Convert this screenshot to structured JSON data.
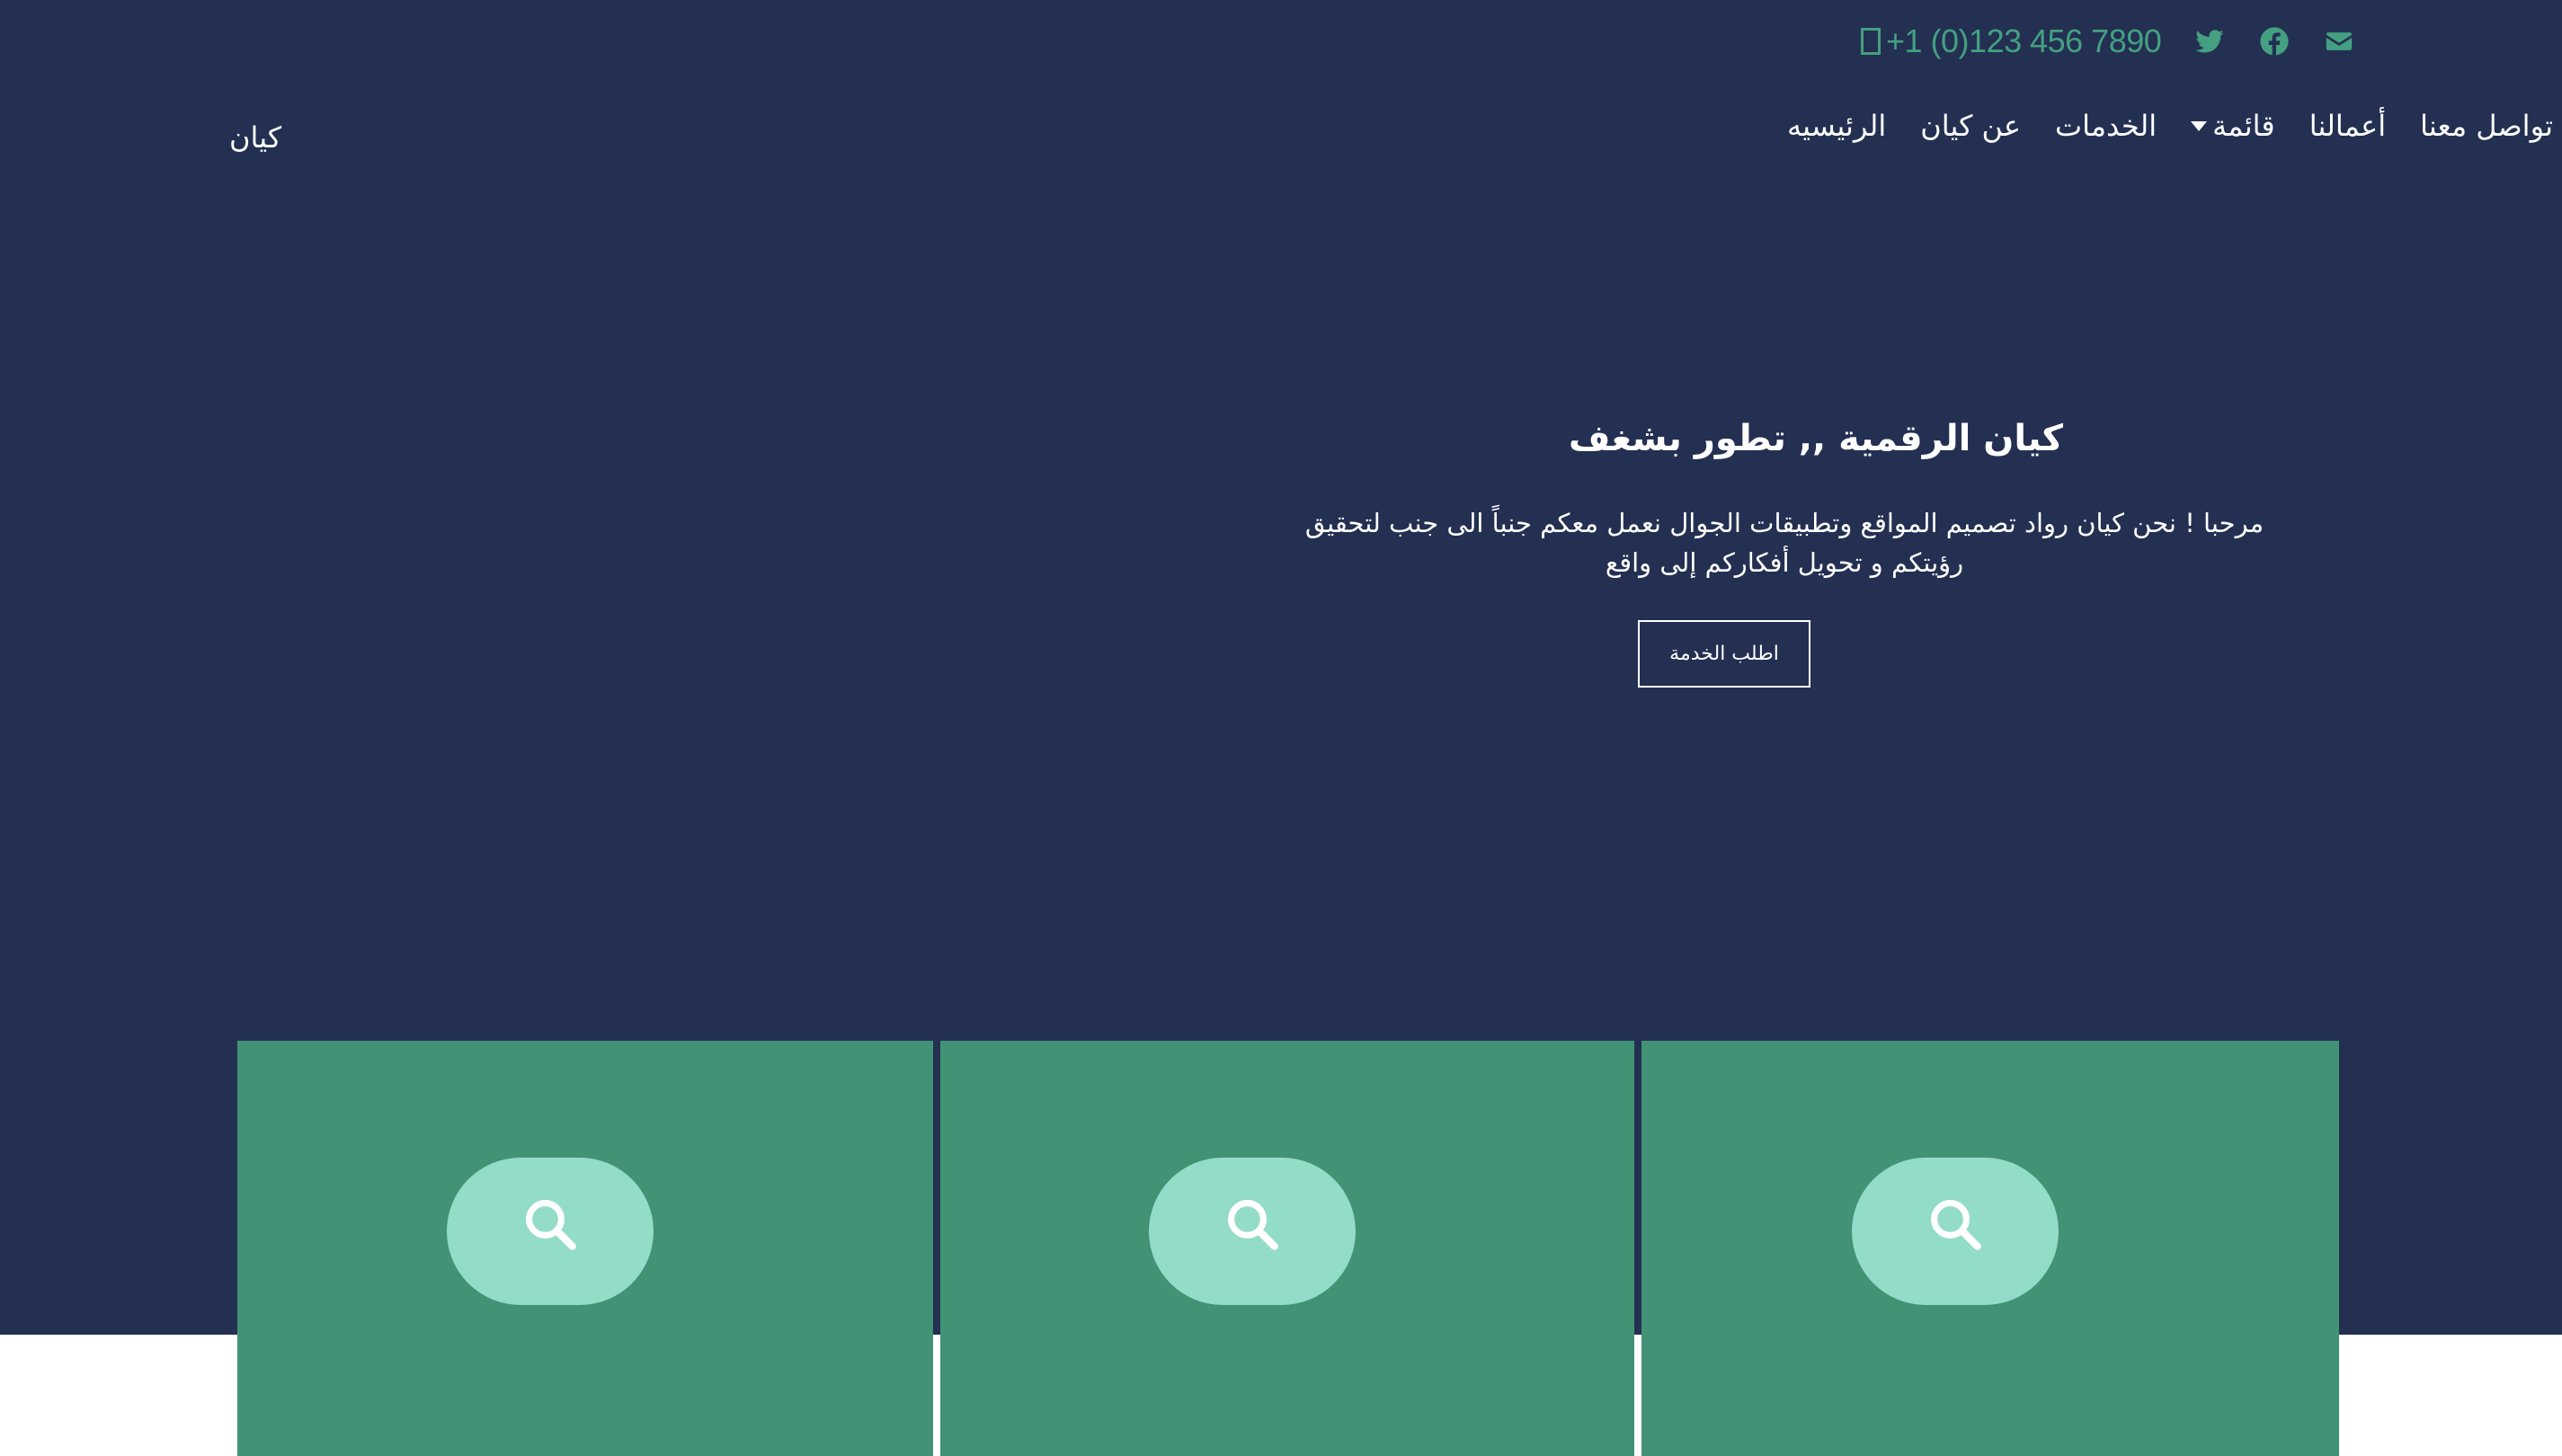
{
  "topbar": {
    "phone": "+1 (0)123 456 7890",
    "icons": [
      "email-icon",
      "facebook-icon",
      "twitter-icon",
      "phone-icon"
    ]
  },
  "nav": {
    "items": [
      {
        "label": "تواصل معنا"
      },
      {
        "label": "أعمالنا"
      },
      {
        "label": "قائمة",
        "has_dropdown": true
      },
      {
        "label": "الخدمات"
      },
      {
        "label": "عن كيان"
      },
      {
        "label": "الرئيسيه"
      }
    ],
    "brand": "كيان"
  },
  "hero": {
    "title": "كيان الرقمية ,, تطور بشغف",
    "text": "مرحبا ! نحن كيان رواد تصميم المواقع وتطبيقات الجوال نعمل معكم جنباً الى جنب لتحقيق رؤيتكم و تحويل أفكاركم إلى واقع",
    "cta": "اطلب الخدمة"
  },
  "features": {
    "cards": [
      {
        "icon": "search-icon"
      },
      {
        "icon": "search-icon"
      },
      {
        "icon": "search-icon"
      }
    ]
  },
  "colors": {
    "hero_bg": "#233052",
    "accent_green": "#429276",
    "pill_mint": "#93dcc8",
    "text_white": "#ffffff",
    "phone_green": "#44a080"
  }
}
